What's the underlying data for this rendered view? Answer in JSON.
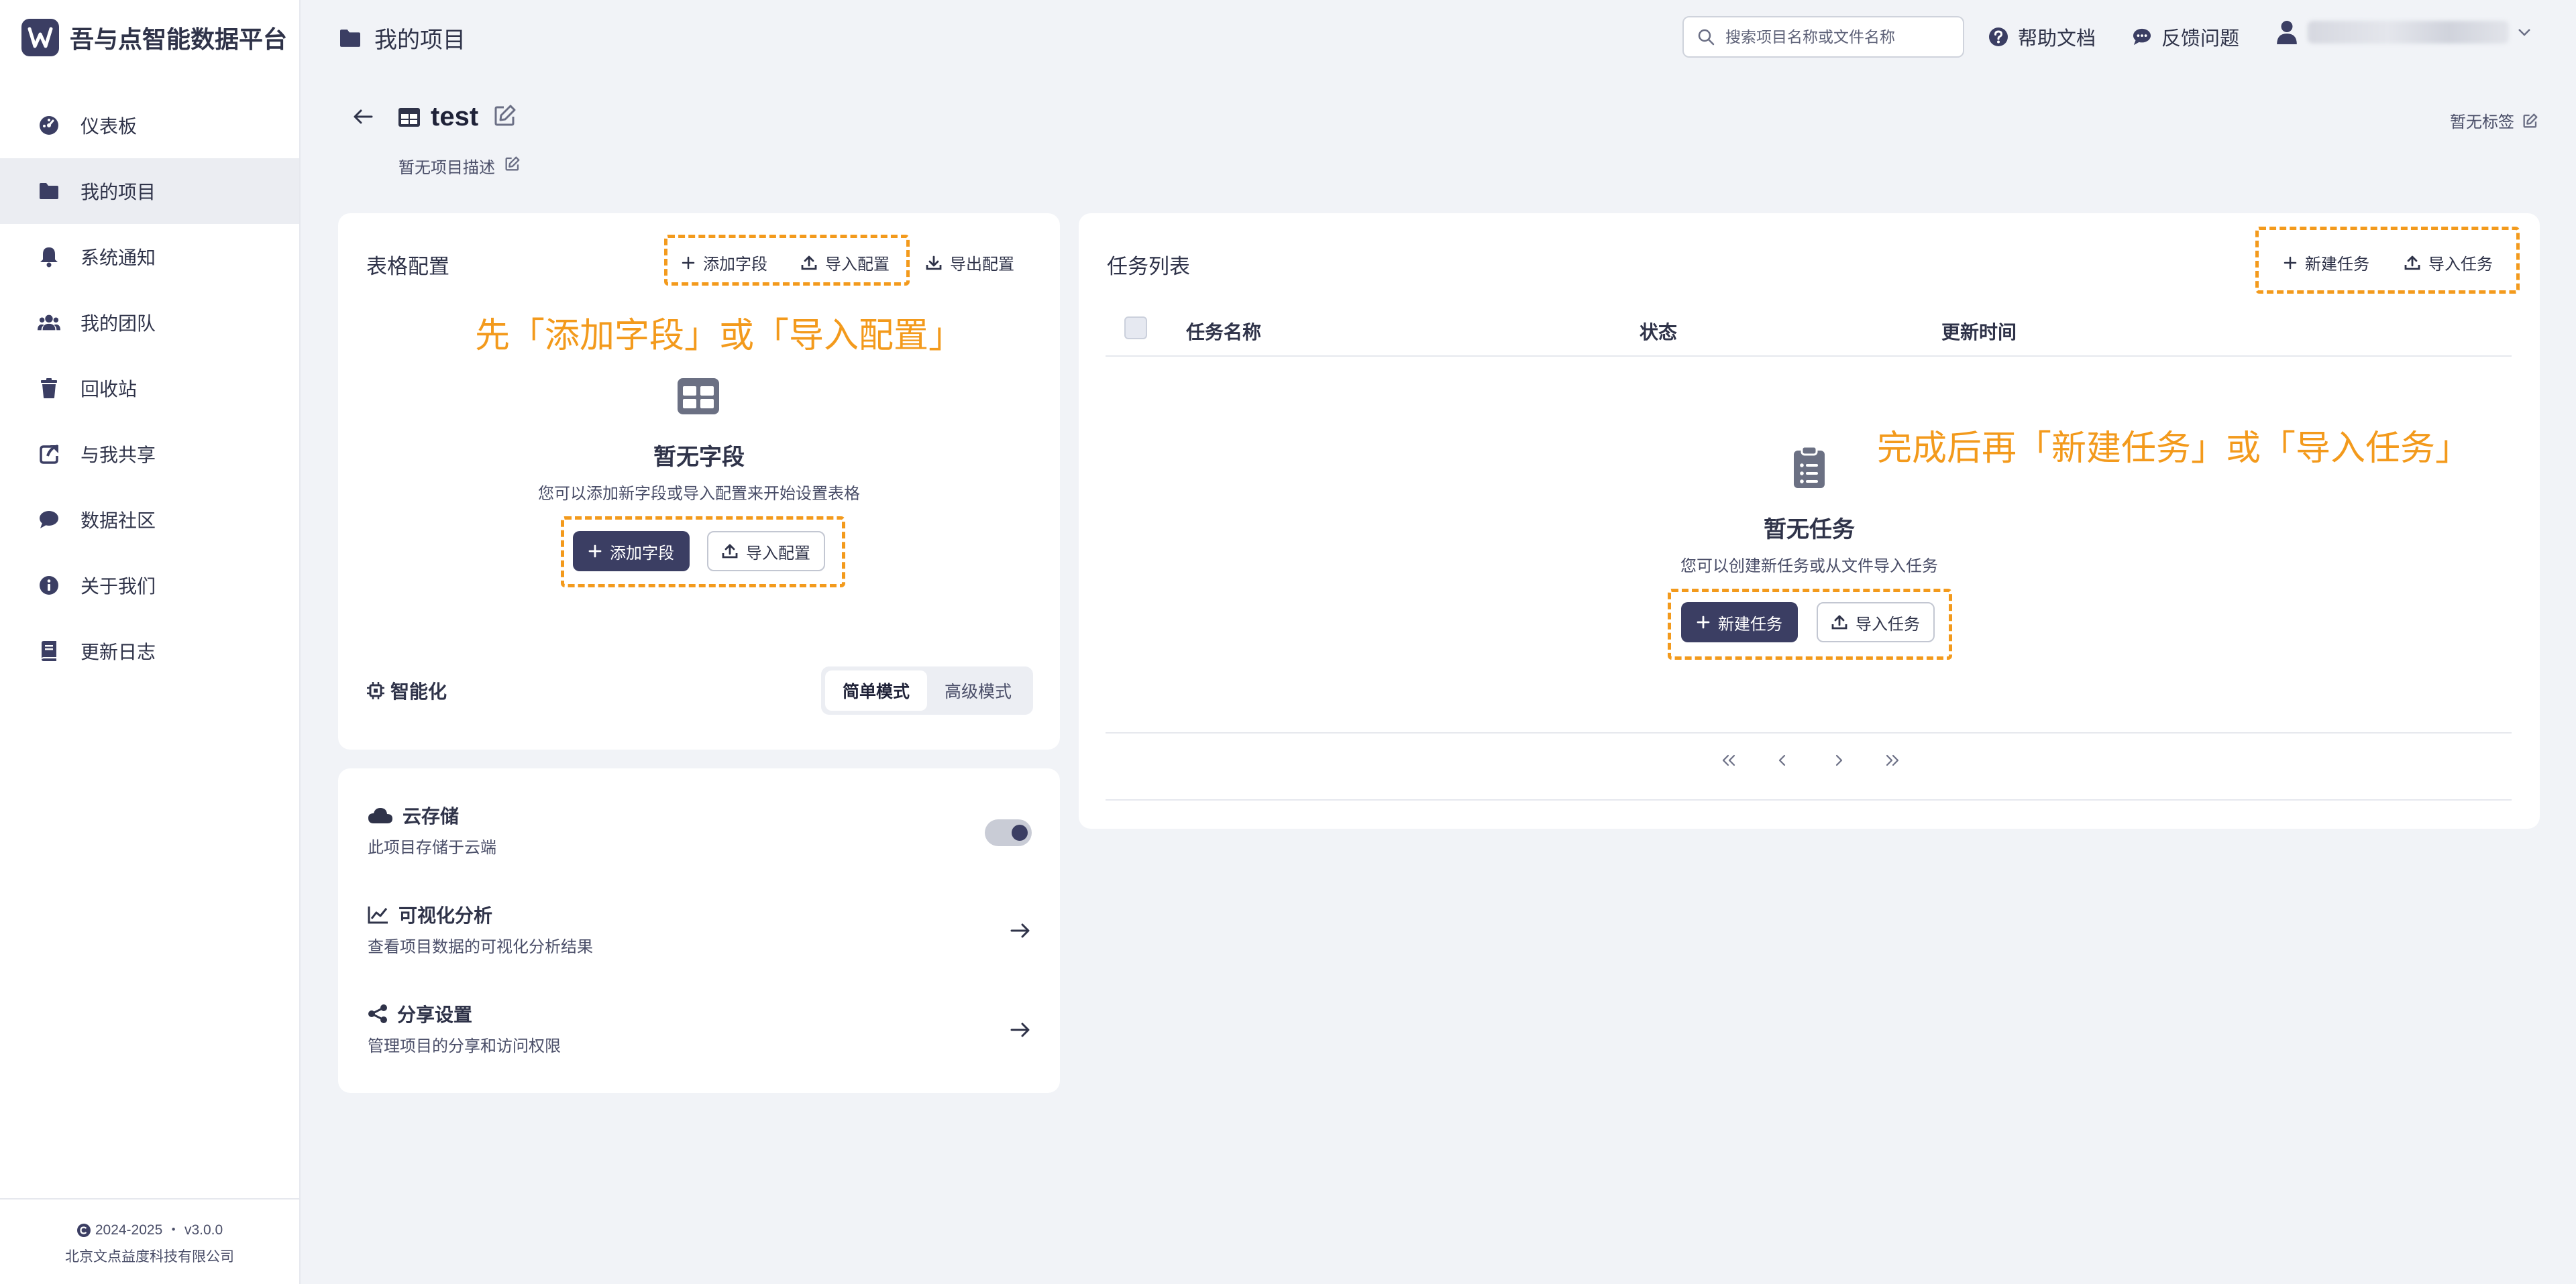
{
  "brand": {
    "name": "吾与点智能数据平台"
  },
  "sidebar": {
    "items": [
      {
        "label": "仪表板",
        "icon": "dashboard-icon"
      },
      {
        "label": "我的项目",
        "icon": "folder-icon",
        "active": true
      },
      {
        "label": "系统通知",
        "icon": "bell-icon"
      },
      {
        "label": "我的团队",
        "icon": "team-icon"
      },
      {
        "label": "回收站",
        "icon": "trash-icon"
      },
      {
        "label": "与我共享",
        "icon": "share-icon"
      },
      {
        "label": "数据社区",
        "icon": "chat-icon"
      },
      {
        "label": "关于我们",
        "icon": "info-icon"
      },
      {
        "label": "更新日志",
        "icon": "book-icon"
      }
    ],
    "footer": {
      "copyright": "2024-2025 ・ v3.0.0",
      "company": "北京文点益度科技有限公司"
    }
  },
  "header": {
    "breadcrumb": "我的项目",
    "search_placeholder": "搜索项目名称或文件名称",
    "help": "帮助文档",
    "feedback": "反馈问题",
    "user": "username_redacted"
  },
  "project": {
    "name": "test",
    "description": "暂无项目描述",
    "tags": "暂无标签"
  },
  "table_config": {
    "title": "表格配置",
    "add_field": "添加字段",
    "import_config": "导入配置",
    "export_config": "导出配置",
    "annotation": "先「添加字段」或「导入配置」",
    "empty_title": "暂无字段",
    "empty_sub": "您可以添加新字段或导入配置来开始设置表格",
    "btn_add": "添加字段",
    "btn_import": "导入配置",
    "smart_label": "智能化",
    "mode_simple": "简单模式",
    "mode_advanced": "高级模式"
  },
  "settings": {
    "cloud": {
      "title": "云存储",
      "desc": "此项目存储于云端",
      "enabled": true
    },
    "viz": {
      "title": "可视化分析",
      "desc": "查看项目数据的可视化分析结果"
    },
    "share": {
      "title": "分享设置",
      "desc": "管理项目的分享和访问权限"
    }
  },
  "tasks": {
    "title": "任务列表",
    "new_task": "新建任务",
    "import_task": "导入任务",
    "columns": [
      "任务名称",
      "状态",
      "更新时间"
    ],
    "annotation": "完成后再「新建任务」或「导入任务」",
    "empty_title": "暂无任务",
    "empty_sub": "您可以创建新任务或从文件导入任务",
    "btn_new": "新建任务",
    "btn_import": "导入任务"
  },
  "colors": {
    "accent": "#3b3e63",
    "annotation": "#f39a1c",
    "background": "#f1f3f7"
  }
}
